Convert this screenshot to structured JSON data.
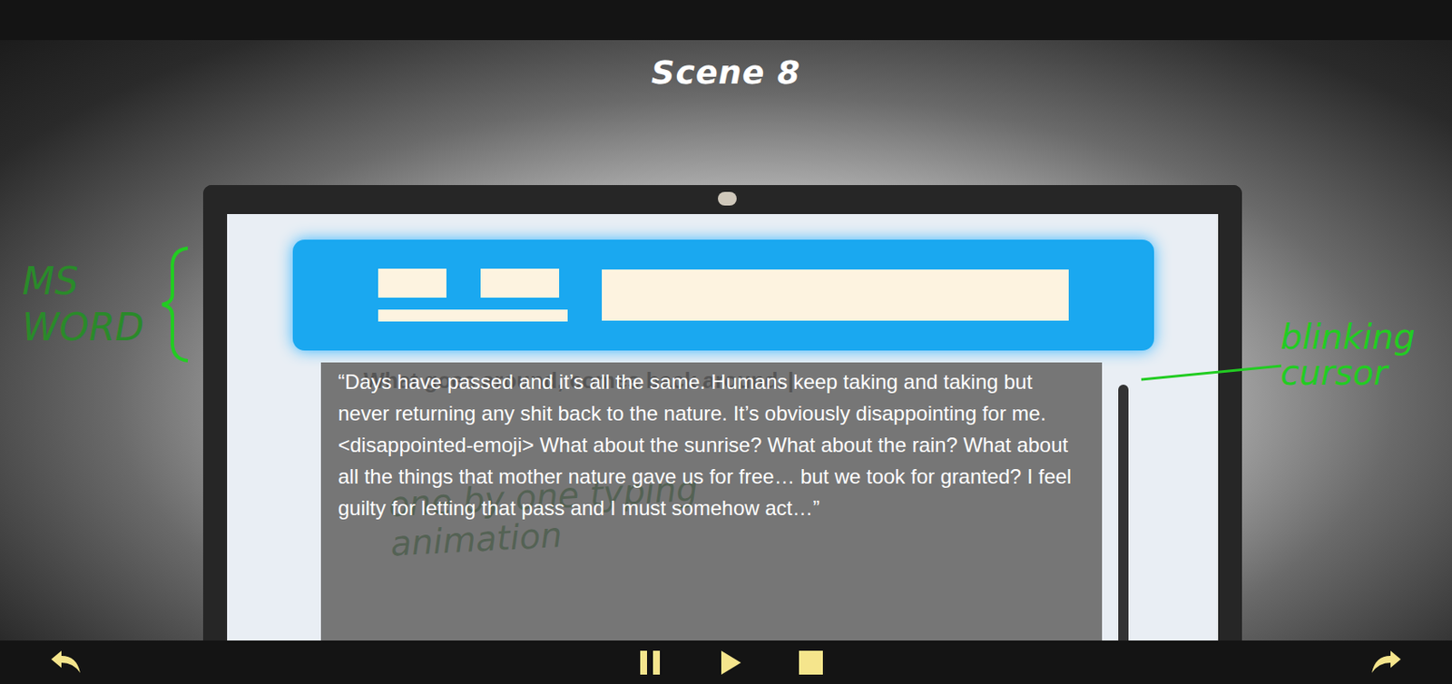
{
  "scene": {
    "title": "Scene 8"
  },
  "document": {
    "text": "What goes around, comes back around.",
    "cursor": "|"
  },
  "caption": "“Days have passed and it’s all the same. Humans keep taking and taking but never returning any shit back to the nature. It’s obviously disappointing for me. <disappointed-emoji> What about the sunrise? What about the rain? What about all the things that mother nature gave us for free… but we took for granted? I feel guilty for letting that pass and I must somehow act…”",
  "annotations": [
    {
      "text": "MS WORD"
    },
    {
      "text": "blinking cursor"
    },
    {
      "text": "one by one typing animation"
    }
  ]
}
